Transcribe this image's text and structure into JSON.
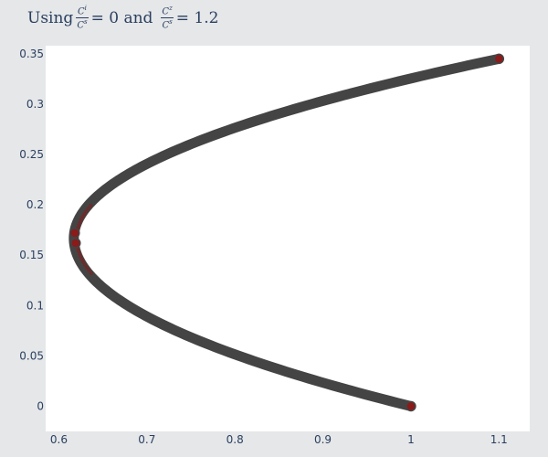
{
  "title": {
    "prefix": "Using",
    "frac1": {
      "num": "C",
      "num_sup": "i",
      "den": "C",
      "den_sup": "s"
    },
    "eq1": "= 0 and",
    "frac2": {
      "num": "C",
      "num_sup": "z",
      "den": "C",
      "den_sup": "s"
    },
    "eq2": "= 1.2"
  },
  "colors": {
    "background": "#e5e7e9",
    "plot_bg": "#ffffff",
    "line": "#444444",
    "marker": "#8b1a1a",
    "text": "#2a3f5f"
  },
  "chart_data": {
    "type": "scatter",
    "mode": "lines+markers",
    "title": "Using Ci/Cs = 0 and Cz/Cs = 1.2",
    "xlabel": "",
    "ylabel": "",
    "xlim": [
      0.585,
      1.135
    ],
    "ylim": [
      -0.025,
      0.358
    ],
    "grid": false,
    "xticks": [
      0.6,
      0.7,
      0.8,
      0.9,
      1,
      1.1
    ],
    "xtick_labels": [
      "0.6",
      "0.7",
      "0.8",
      "0.9",
      "1",
      "1.1"
    ],
    "yticks": [
      0,
      0.05,
      0.1,
      0.15,
      0.2,
      0.25,
      0.3,
      0.35
    ],
    "ytick_labels": [
      "0",
      "0.05",
      "0.1",
      "0.15",
      "0.2",
      "0.25",
      "0.3",
      "0.35"
    ],
    "curve": {
      "description": "parabola opening right",
      "vertex": {
        "x": 0.617,
        "y": 0.1667
      },
      "start": {
        "x": 1.0,
        "y": 0.0
      },
      "end": {
        "x": 1.1,
        "y": 0.345
      }
    },
    "markers": [
      {
        "x": 1.0,
        "y": 0.0
      },
      {
        "x": 0.619,
        "y": 0.162
      },
      {
        "x": 0.618,
        "y": 0.172
      },
      {
        "x": 1.1,
        "y": 0.345
      }
    ]
  }
}
